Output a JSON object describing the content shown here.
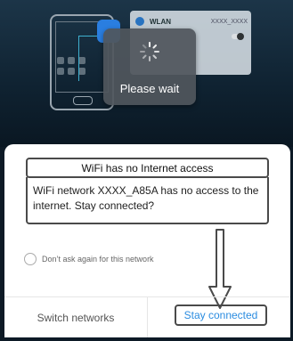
{
  "background": {
    "wlan_label": "WLAN",
    "wlan_ssid": "XXXX_XXXX"
  },
  "toast": {
    "text": "Please wait"
  },
  "dialog": {
    "title": "WiFi has no Internet access",
    "message": "WiFi network XXXX_A85A has no access to the internet. Stay connected?",
    "checkbox_label": "Don’t ask again for this network",
    "switch_button": "Switch networks",
    "stay_button": "Stay connected"
  },
  "colors": {
    "accent": "#2b8ce0",
    "annotation": "#4a4a4a"
  }
}
